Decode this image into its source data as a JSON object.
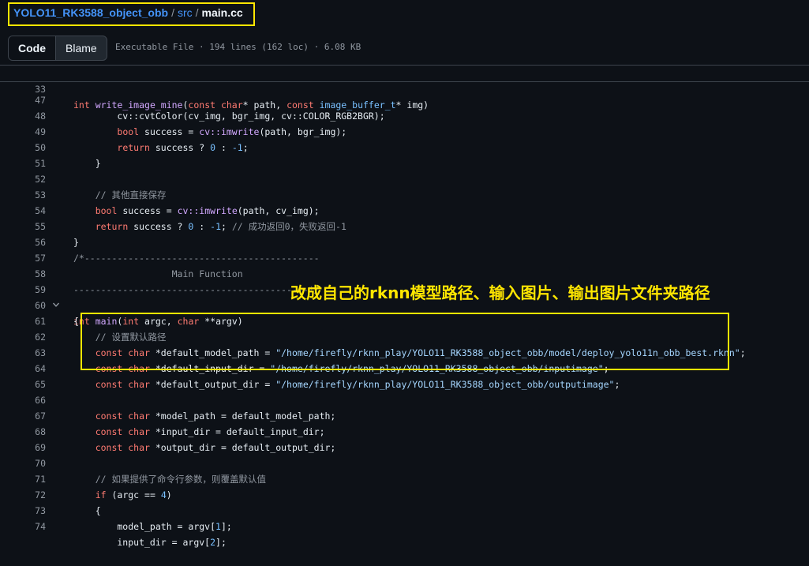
{
  "breadcrumb": {
    "repo": "YOLO11_RK3588_object_obb",
    "sep": "/",
    "dir": "src",
    "file": "main.cc"
  },
  "toolbar": {
    "code_label": "Code",
    "blame_label": "Blame",
    "meta": "Executable File · 194 lines (162 loc) · 6.08 KB"
  },
  "colors": {
    "highlight_box": "#ffe600",
    "keyword": "#ff7b72",
    "function": "#d2a8ff",
    "string": "#a5d6ff",
    "comment": "#9198a1"
  },
  "annotation": "改成自己的rknn模型路径、输入图片、输出图片文件夹路径",
  "sticky": {
    "num": "33",
    "t0": "int ",
    "t1": "write_image_mine",
    "t2": "(",
    "t3": "const char",
    "t4": "* path, ",
    "t5": "const ",
    "t6": "image_buffer_t",
    "t7": "* img)"
  },
  "lines": {
    "l47": {
      "num": "47",
      "t0": "        cv::cvtColor(cv_img, bgr_img, cv::COLOR_RGB2BGR);"
    },
    "l48": {
      "num": "48",
      "t0": "        ",
      "t1": "bool",
      "t2": " success = ",
      "t3": "cv::imwrite",
      "t4": "(path, bgr_img);"
    },
    "l49": {
      "num": "49",
      "t0": "        ",
      "t1": "return",
      "t2": " success ? ",
      "t3": "0",
      "t4": " : ",
      "t5": "-1",
      "t6": ";"
    },
    "l50": {
      "num": "50",
      "t0": "    }"
    },
    "l51": {
      "num": "51"
    },
    "l52": {
      "num": "52",
      "t0": "    ",
      "t1": "// 其他直接保存"
    },
    "l53": {
      "num": "53",
      "t0": "    ",
      "t1": "bool",
      "t2": " success = ",
      "t3": "cv::imwrite",
      "t4": "(path, cv_img);"
    },
    "l54": {
      "num": "54",
      "t0": "    ",
      "t1": "return",
      "t2": " success ? ",
      "t3": "0",
      "t4": " : ",
      "t5": "-1",
      "t6": "; ",
      "t7": "// 成功返回0，失败返回-1"
    },
    "l55": {
      "num": "55",
      "t0": "}"
    },
    "l56": {
      "num": "56",
      "t0": "/*-------------------------------------------"
    },
    "l57": {
      "num": "57",
      "t0": "                  Main Function"
    },
    "l58": {
      "num": "58",
      "t0": "-------------------------------------------*/"
    },
    "l59": {
      "num": "59",
      "t0": "int ",
      "t1": "main",
      "t2": "(",
      "t3": "int",
      "t4": " argc, ",
      "t5": "char",
      "t6": " **argv)"
    },
    "l60": {
      "num": "60",
      "t0": "{"
    },
    "l61": {
      "num": "61",
      "t0": "    ",
      "t1": "// 设置默认路径"
    },
    "l62": {
      "num": "62",
      "t0": "    ",
      "t1": "const char",
      "t2": " *default_model_path = ",
      "t3": "\"/home/firefly/rknn_play/YOLO11_RK3588_object_obb/model/deploy_yolo11n_obb_best.rknn\"",
      "t4": ";"
    },
    "l63": {
      "num": "63",
      "t0": "    ",
      "t1": "const char",
      "t2": " *default_input_dir = ",
      "t3": "\"/home/firefly/rknn_play/YOLO11_RK3588_object_obb/inputimage\"",
      "t4": ";"
    },
    "l64": {
      "num": "64",
      "t0": "    ",
      "t1": "const char",
      "t2": " *default_output_dir = ",
      "t3": "\"/home/firefly/rknn_play/YOLO11_RK3588_object_obb/outputimage\"",
      "t4": ";"
    },
    "l65": {
      "num": "65"
    },
    "l66": {
      "num": "66",
      "t0": "    ",
      "t1": "const char",
      "t2": " *model_path = default_model_path;"
    },
    "l67": {
      "num": "67",
      "t0": "    ",
      "t1": "const char",
      "t2": " *input_dir = default_input_dir;"
    },
    "l68": {
      "num": "68",
      "t0": "    ",
      "t1": "const char",
      "t2": " *output_dir = default_output_dir;"
    },
    "l69": {
      "num": "69"
    },
    "l70": {
      "num": "70",
      "t0": "    ",
      "t1": "// 如果提供了命令行参数，则覆盖默认值"
    },
    "l71": {
      "num": "71",
      "t0": "    ",
      "t1": "if",
      "t2": " (argc == ",
      "t3": "4",
      "t4": ")"
    },
    "l72": {
      "num": "72",
      "t0": "    {"
    },
    "l73": {
      "num": "73",
      "t0": "        model_path = argv[",
      "t1": "1",
      "t2": "];"
    },
    "l74": {
      "num": "74",
      "t0": "        input_dir = argv[",
      "t1": "2",
      "t2": "];"
    }
  }
}
